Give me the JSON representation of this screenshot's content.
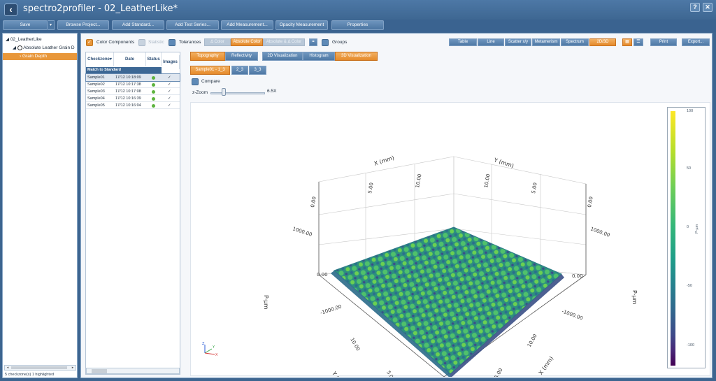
{
  "window": {
    "title": "spectro2profiler - 02_LeatherLike*",
    "help_label": "?",
    "close_label": "✕"
  },
  "toolbar": {
    "buttons": [
      "Save",
      "Browse Project...",
      "Add Standard...",
      "Add Test Series...",
      "Add Measurement...",
      "Opacity Measurement",
      "Properties"
    ],
    "save_dropdown_icon": "▾"
  },
  "tree": {
    "items": [
      "02_LeatherLike",
      "Absolute Leather Grain D",
      "Grain Depth"
    ],
    "status": "5 checkzone(s) 1 highlighted"
  },
  "options": {
    "color_components": "Color Components",
    "statistic": "Statistic",
    "tolerances": "Tolerances",
    "groups": "Groups",
    "compare": "Compare",
    "color_modes": [
      "Δ Color",
      "Absolute Color",
      "Absolute & Δ Color"
    ],
    "active_color_mode": "Absolute Color"
  },
  "view_tabs": [
    "Table",
    "Line",
    "Scatter x/y",
    "Metamerism",
    "Spectrum",
    "2D/3D"
  ],
  "active_view_tab": "2D/3D",
  "right_buttons": {
    "print": "Print",
    "export": "Export..."
  },
  "mode_tabs": [
    "Topography",
    "Reflectivity"
  ],
  "viz_tabs": [
    "2D Visualization",
    "Histogram",
    "3D Visualization"
  ],
  "active_viz_tab": "3D Visualization",
  "sample_tabs": [
    "Sample01 - 1_3",
    "2_3",
    "3_3"
  ],
  "zoom": {
    "label": "z-Zoom",
    "value": "6.5X",
    "level": 0.22
  },
  "table": {
    "headers": [
      "Checkzone▾",
      "Date",
      "Status",
      "Images"
    ],
    "group": "Match to Standard",
    "rows": [
      {
        "name": "Sample01",
        "date": "17/12 10:18:09",
        "status": "ok",
        "image": "✓"
      },
      {
        "name": "Sample02",
        "date": "17/12 10:17:38",
        "status": "ok",
        "image": "✓"
      },
      {
        "name": "Sample03",
        "date": "17/12 10:17:08",
        "status": "ok",
        "image": "✓"
      },
      {
        "name": "Sample04",
        "date": "17/12 10:16:39",
        "status": "ok",
        "image": "✓"
      },
      {
        "name": "Sample05",
        "date": "17/12 10:16:04",
        "status": "ok",
        "image": "✓"
      }
    ]
  },
  "plot": {
    "x_label": "X (mm)",
    "y_label": "Y (mm)",
    "z_label": "P-µm",
    "x_ticks": [
      "0.00",
      "5.00",
      "10.00"
    ],
    "y_ticks": [
      "10.00",
      "5.00",
      "0.00"
    ],
    "z_ticks": [
      "1000.00",
      "0.00",
      "-1000.00"
    ],
    "axes_gizmo_labels": [
      "Z",
      "Y",
      "X"
    ]
  },
  "colorbar": {
    "ticks": [
      "100",
      "50",
      "0",
      "-50",
      "-100"
    ],
    "label": "P-µm",
    "colormap": "viridis"
  },
  "icons": {
    "back": "arrow-left-icon",
    "layout_a": "grid-icon",
    "layout_b": "list-icon",
    "groups": "link-icon"
  }
}
